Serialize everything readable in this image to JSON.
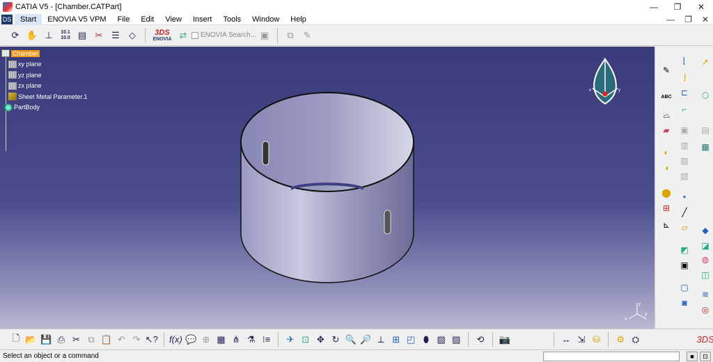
{
  "window": {
    "title": "CATIA V5 - [Chamber.CATPart]",
    "controls": [
      "—",
      "❐",
      "✕"
    ]
  },
  "menubar": {
    "logo": "DS",
    "items": [
      "Start",
      "ENOVIA V5 VPM",
      "File",
      "Edit",
      "View",
      "Insert",
      "Tools",
      "Window",
      "Help"
    ],
    "doc_controls": [
      "—",
      "❐",
      "✕"
    ]
  },
  "toolbar_top": {
    "enovia_logo": "ENOVIA",
    "enovia_ds": "3DS",
    "search_label": "ENOVIA Search...",
    "measure_readout_top": "10.1",
    "measure_readout_bottom": "10.0",
    "icons": [
      "refresh-icon",
      "pan-icon",
      "axis-icon",
      "measure-icon",
      "stack-icon",
      "cut-icon",
      "list-icon",
      "eraser-icon"
    ]
  },
  "tree": {
    "items": [
      {
        "label": "Chamber",
        "icon": "part-icon",
        "selected": true
      },
      {
        "label": "xy plane",
        "icon": "plane-icon"
      },
      {
        "label": "yz plane",
        "icon": "plane-icon"
      },
      {
        "label": "zx plane",
        "icon": "plane-icon"
      },
      {
        "label": "Sheet Metal Parameter.1",
        "icon": "sheet-metal-icon"
      },
      {
        "label": "PartBody",
        "icon": "part-body-icon"
      }
    ]
  },
  "viewport": {
    "compass_axes": [
      "x",
      "y",
      "z"
    ],
    "model": "cylinder with four slots"
  },
  "status": {
    "message": "Select an object or a command",
    "command_value": ""
  },
  "colors": {
    "viewport_top": "#3a3b7a",
    "viewport_bottom": "#b9b9d2",
    "selected_node": "#f39a1c"
  }
}
